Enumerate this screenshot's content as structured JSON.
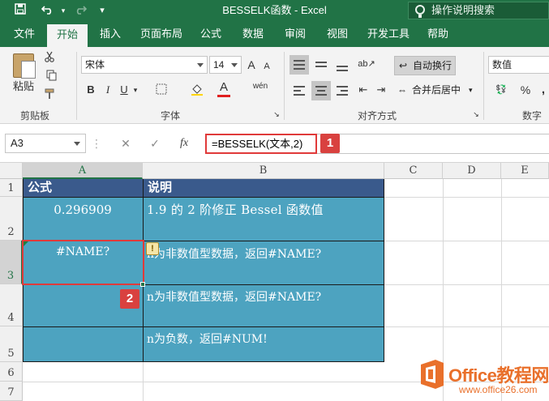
{
  "window": {
    "title": "BESSELK函数  -  Excel",
    "tell_me": "操作说明搜索"
  },
  "quick_access": {
    "customize_glyph": "▾"
  },
  "tabs": [
    {
      "label": "文件"
    },
    {
      "label": "开始"
    },
    {
      "label": "插入"
    },
    {
      "label": "页面布局"
    },
    {
      "label": "公式"
    },
    {
      "label": "数据"
    },
    {
      "label": "审阅"
    },
    {
      "label": "视图"
    },
    {
      "label": "开发工具"
    },
    {
      "label": "帮助"
    }
  ],
  "ribbon": {
    "clipboard": {
      "paste_label": "粘贴",
      "group_label": "剪贴板"
    },
    "font": {
      "font_name": "宋体",
      "font_size": "14",
      "group_label": "字体",
      "grow": "A",
      "shrink": "A",
      "bold": "B",
      "italic": "I",
      "underline": "U",
      "font_color": "A",
      "wen": "wén"
    },
    "alignment": {
      "wrap_text": "自动换行",
      "merge_center": "合并后居中",
      "group_label": "对齐方式"
    },
    "number": {
      "format": "数值",
      "group_label": "数字",
      "percent": "%",
      "comma": ","
    }
  },
  "formula_bar": {
    "name_box": "A3",
    "cancel": "✕",
    "enter": "✓",
    "fx": "fx",
    "formula": "=BESSELK(文本,2)"
  },
  "badges": {
    "one": "1",
    "two": "2"
  },
  "columns": [
    "A",
    "B",
    "C",
    "D",
    "E"
  ],
  "rows": [
    "1",
    "2",
    "3",
    "4",
    "5",
    "6",
    "7"
  ],
  "cells": {
    "A1": "公式",
    "B1": "说明",
    "A2": "0.296909",
    "B2": "1.9 的 2 阶修正 Bessel 函数值",
    "A3": "#NAME?",
    "B3": "n为非数值型数据，返回#NAME?",
    "B4": "n为非数值型数据，返回#NAME?",
    "B5": "n为负数，返回#NUM!"
  },
  "watermark": {
    "brand": "Office教程网",
    "url": "www.office26.com"
  },
  "colors": {
    "excel_green": "#217346",
    "header_fill": "#3a5a8c",
    "body_fill": "#4da3c0",
    "highlight_red": "#e03a3a",
    "watermark_orange": "#e9702b"
  }
}
